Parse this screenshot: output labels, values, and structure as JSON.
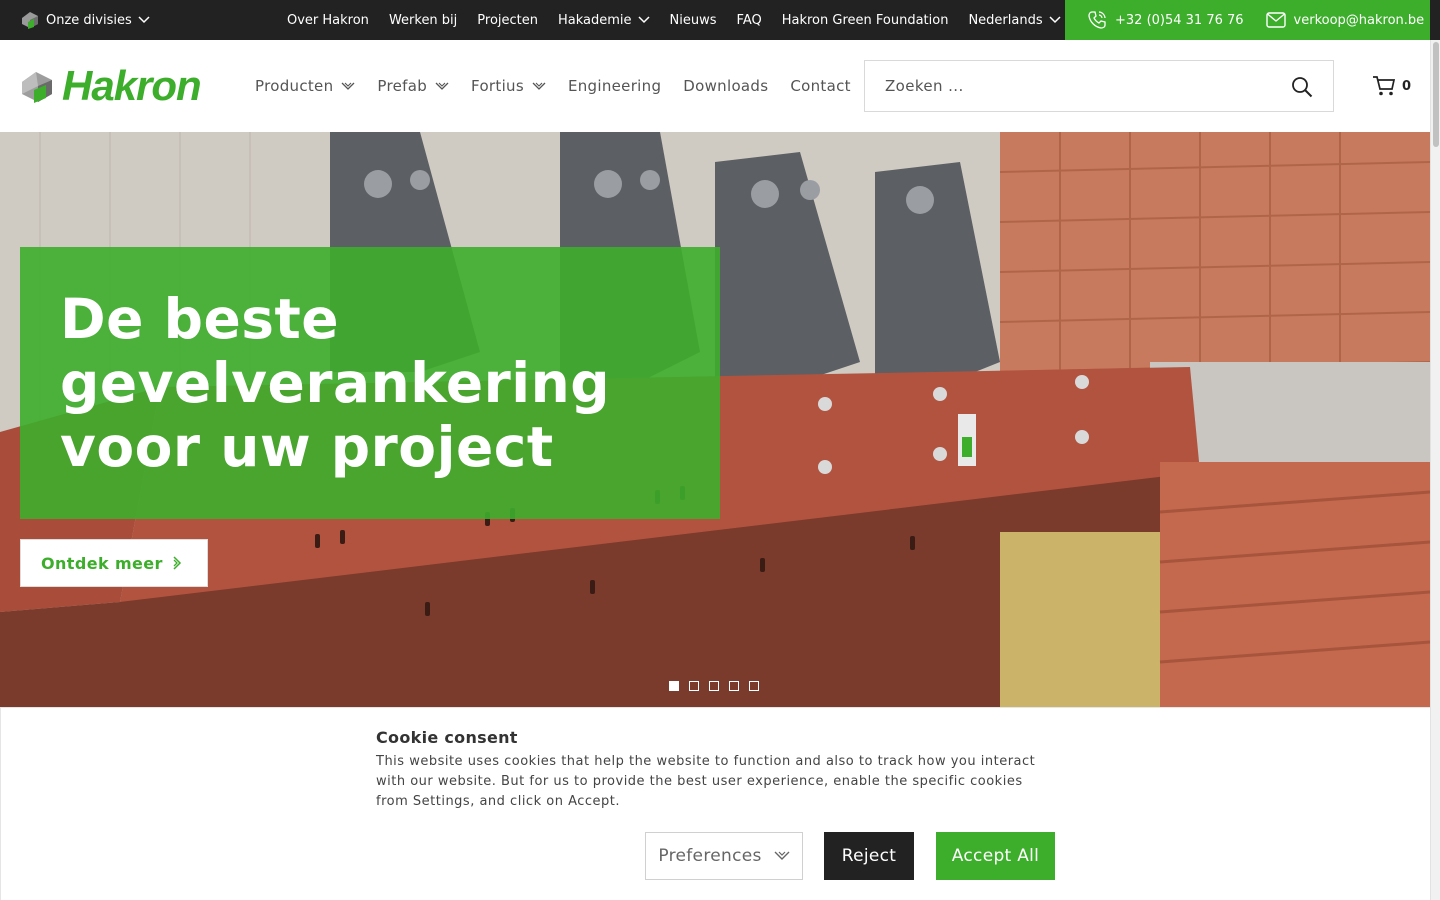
{
  "topbar": {
    "divisions_label": "Onze divisies",
    "links": [
      "Over Hakron",
      "Werken bij",
      "Projecten",
      "Hakademie",
      "Nieuws",
      "FAQ",
      "Hakron Green Foundation",
      "Nederlands"
    ],
    "phone": "+32 (0)54 31 76 76",
    "email": "verkoop@hakron.be"
  },
  "header": {
    "brand": "Hakron",
    "nav": [
      "Producten",
      "Prefab",
      "Fortius",
      "Engineering",
      "Downloads",
      "Contact"
    ],
    "search_placeholder": "Zoeken ...",
    "cart_count": "0"
  },
  "hero": {
    "headline": "De beste gevelverankering voor uw project",
    "cta_label": "Ontdek meer",
    "slide_count": 5,
    "active_slide": 1
  },
  "cookie": {
    "title": "Cookie consent",
    "description": "This website uses cookies that help the website to function and also to track how you interact with our website. But for us to provide the best user experience, enable the specific cookies from Settings, and click on Accept.",
    "preferences_label": "Preferences",
    "reject_label": "Reject",
    "accept_label": "Accept All"
  },
  "colors": {
    "brand_green": "#3dae2b",
    "topbar_dark": "#222222",
    "reject_dark": "#222222"
  }
}
